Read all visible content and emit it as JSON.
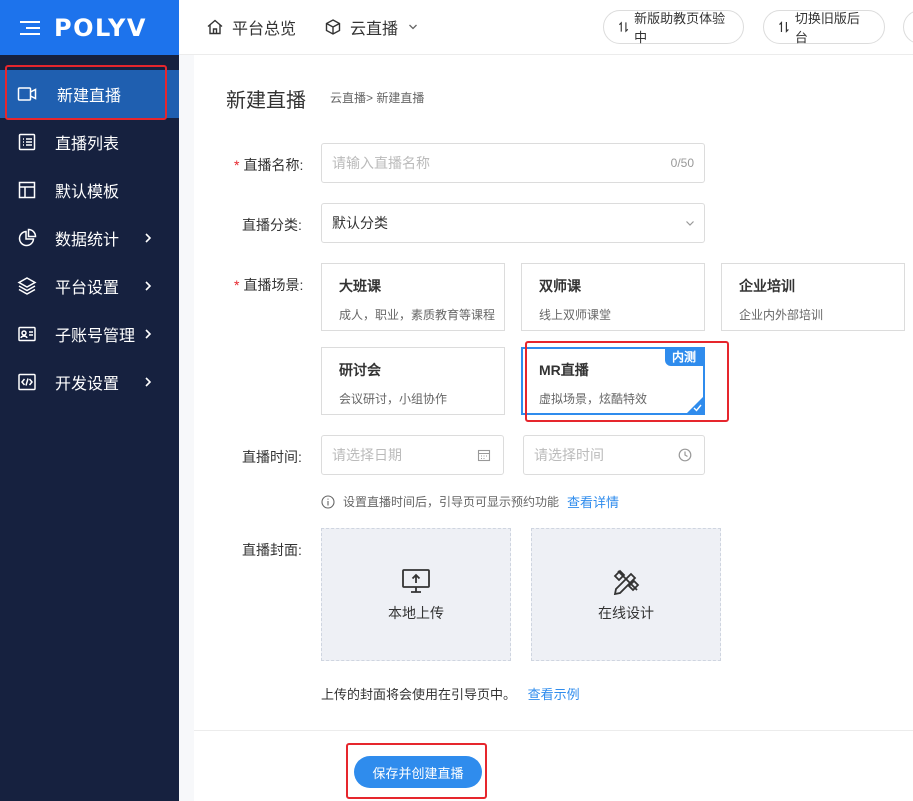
{
  "brand": {
    "logo_text": "POLYV"
  },
  "sidebar": {
    "items": [
      {
        "label": "新建直播",
        "icon": "video-camera-icon",
        "active": true
      },
      {
        "label": "直播列表",
        "icon": "list-icon"
      },
      {
        "label": "默认模板",
        "icon": "template-layout-icon"
      },
      {
        "label": "数据统计",
        "icon": "pie-chart-icon",
        "has_submenu": true
      },
      {
        "label": "平台设置",
        "icon": "layers-icon",
        "has_submenu": true
      },
      {
        "label": "子账号管理",
        "icon": "id-card-icon",
        "has_submenu": true
      },
      {
        "label": "开发设置",
        "icon": "code-icon",
        "has_submenu": true
      }
    ]
  },
  "topbar": {
    "home_label": "平台总览",
    "cloud_label": "云直播",
    "new_version_label": "新版助教页体验中",
    "switch_old_label": "切换旧版后台"
  },
  "page": {
    "title": "新建直播",
    "breadcrumb": "云直播> 新建直播"
  },
  "form": {
    "name_label": "直播名称:",
    "name_placeholder": "请输入直播名称",
    "name_counter": "0/50",
    "category_label": "直播分类:",
    "category_value": "默认分类",
    "scene_label": "直播场景:",
    "scenes": [
      {
        "title": "大班课",
        "desc": "成人，职业，素质教育等课程"
      },
      {
        "title": "双师课",
        "desc": "线上双师课堂"
      },
      {
        "title": "企业培训",
        "desc": "企业内外部培训"
      },
      {
        "title": "研讨会",
        "desc": "会议研讨，小组协作"
      },
      {
        "title": "MR直播",
        "desc": "虚拟场景，炫酷特效",
        "badge": "内测",
        "selected": true
      }
    ],
    "time_label": "直播时间:",
    "date_placeholder": "请选择日期",
    "time_placeholder": "请选择时间",
    "time_hint": "设置直播时间后，引导页可显示预约功能",
    "time_hint_link": "查看详情",
    "cover_label": "直播封面:",
    "upload_local": "本地上传",
    "upload_design": "在线设计",
    "cover_note": "上传的封面将会使用在引导页中。",
    "cover_note_link": "查看示例",
    "submit_label": "保存并创建直播"
  },
  "colors": {
    "accent": "#2f8ced",
    "sidebar_bg": "#16213f",
    "brand_bg": "#1d73ec",
    "highlight_red": "#e6262d"
  }
}
